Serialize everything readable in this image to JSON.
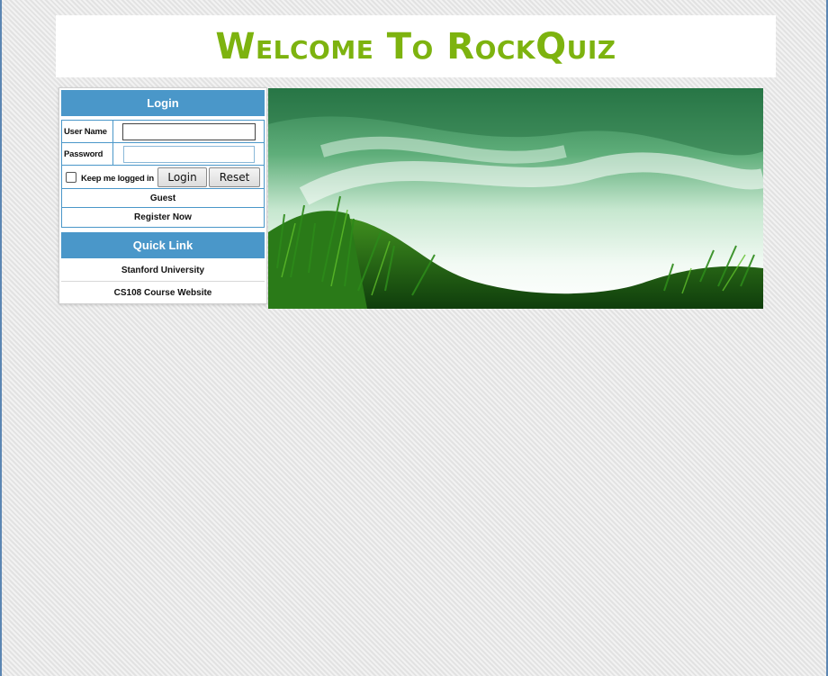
{
  "header": {
    "title": "Welcome To RockQuiz",
    "title_color": "#7db30f"
  },
  "login": {
    "heading": "Login",
    "username_label": "User Name",
    "username_value": "",
    "password_label": "Password",
    "password_value": "",
    "keep_logged_in_label": "Keep me logged in",
    "keep_logged_in_checked": false,
    "login_button": "Login",
    "reset_button": "Reset",
    "guest_link": "Guest",
    "register_link": "Register Now"
  },
  "quick_link": {
    "heading": "Quick Link",
    "items": [
      {
        "label": "Stanford University"
      },
      {
        "label": "CS108 Course Website"
      }
    ]
  },
  "theme": {
    "section_header_color": "#4a97c9"
  }
}
